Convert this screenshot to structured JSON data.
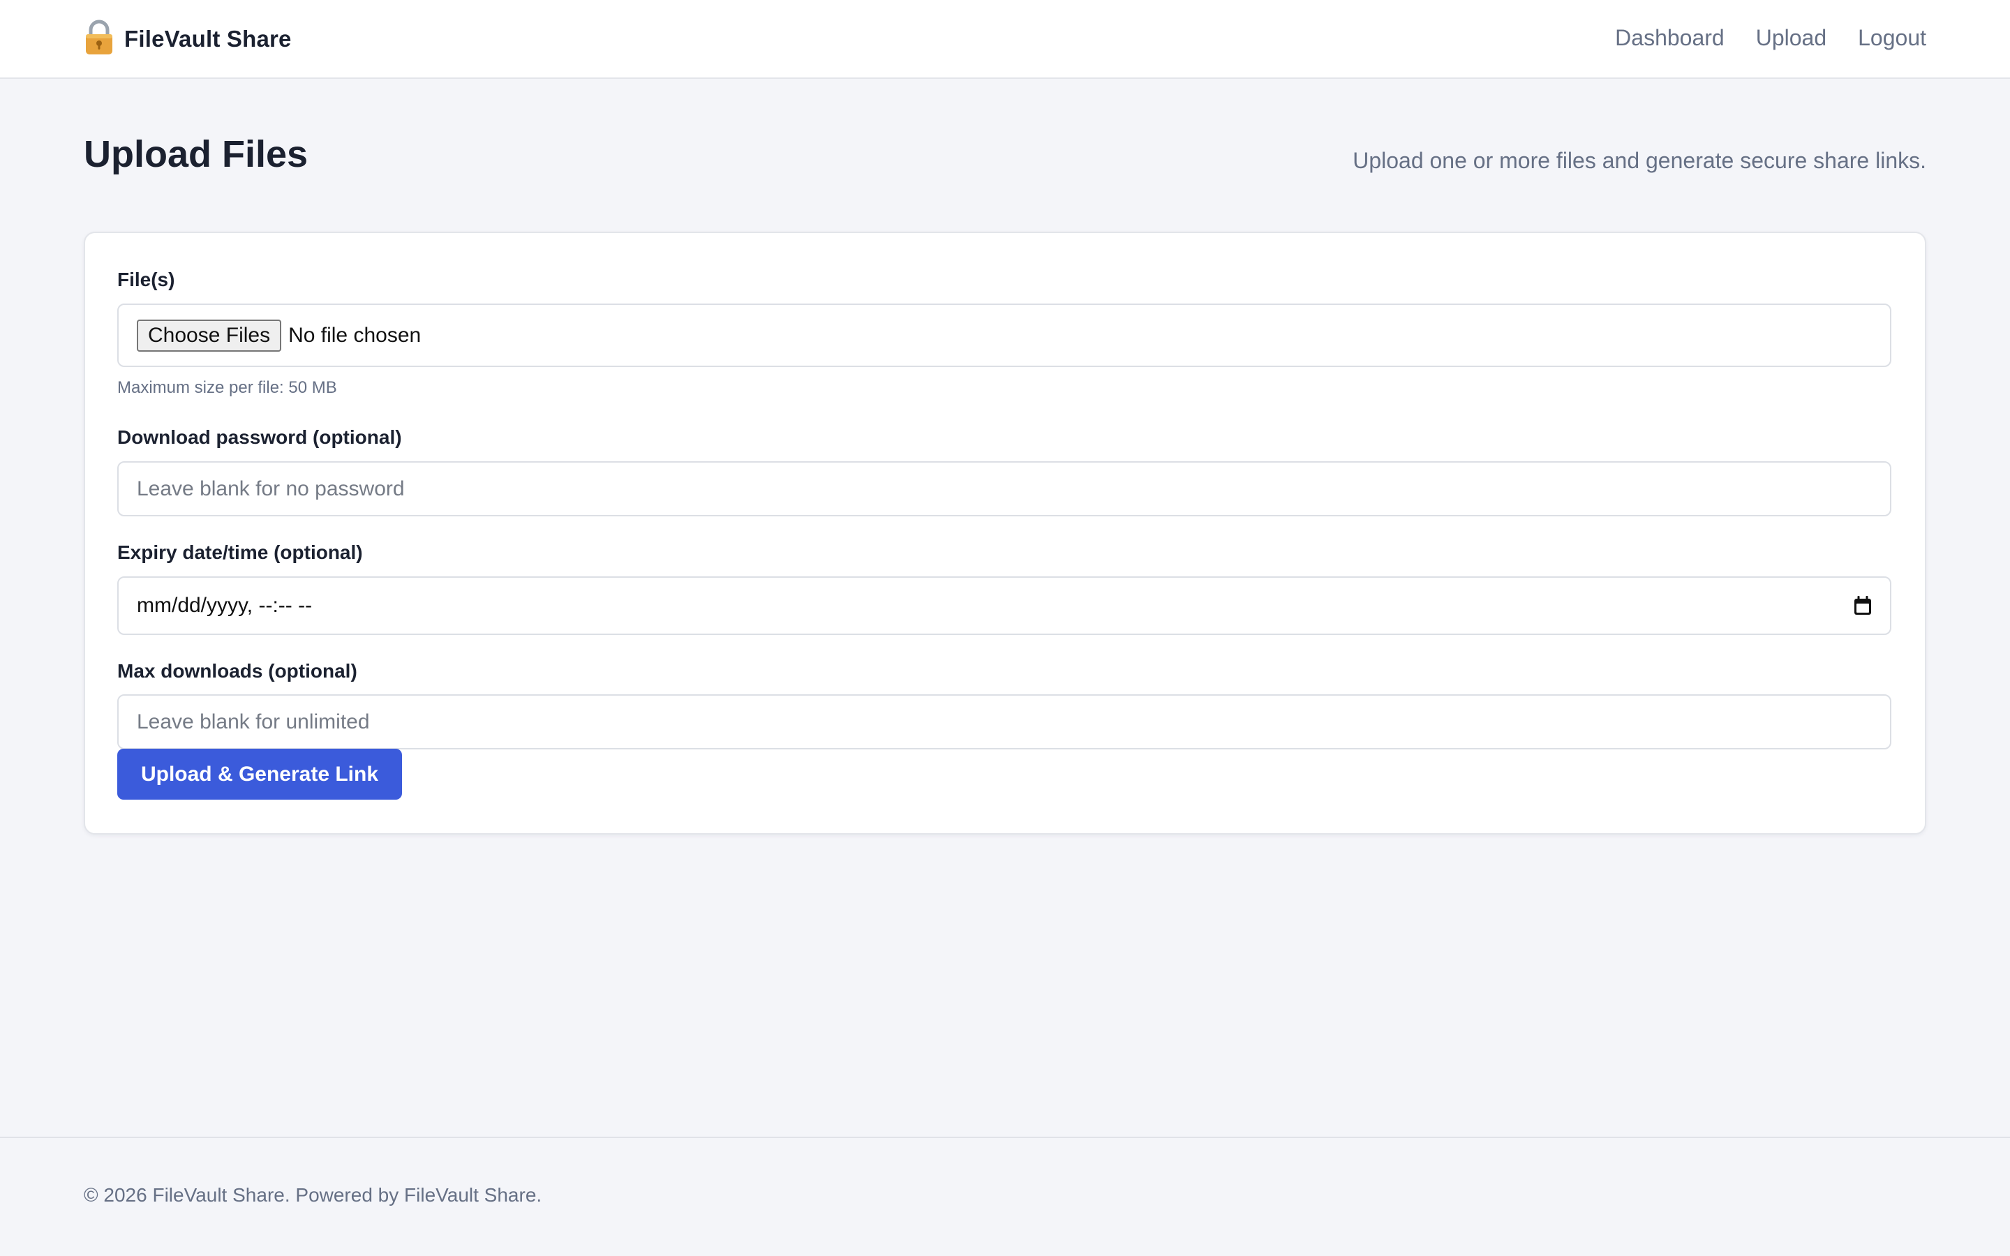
{
  "header": {
    "brand_icon": "lock-icon",
    "brand_name": "FileVault Share",
    "nav": [
      "Dashboard",
      "Upload",
      "Logout"
    ]
  },
  "page": {
    "title": "Upload Files",
    "subtitle": "Upload one or more files and generate secure share links."
  },
  "form": {
    "files": {
      "label": "File(s)",
      "button_label": "Choose Files",
      "status": "No file chosen",
      "help": "Maximum size per file: 50 MB"
    },
    "password": {
      "label": "Download password (optional)",
      "placeholder": "Leave blank for no password",
      "value": ""
    },
    "expiry": {
      "label": "Expiry date/time (optional)",
      "value_display": "mm/dd/yyyy, --:-- --",
      "icon": "calendar-icon"
    },
    "max_downloads": {
      "label": "Max downloads (optional)",
      "placeholder": "Leave blank for unlimited",
      "value": ""
    },
    "submit_label": "Upload & Generate Link"
  },
  "footer": {
    "text": "© 2026 FileVault Share. Powered by FileVault Share."
  },
  "colors": {
    "accent": "#3b5bdb",
    "background": "#f4f5f9",
    "muted_text": "#667085",
    "lock_icon": "#e8a33c"
  }
}
